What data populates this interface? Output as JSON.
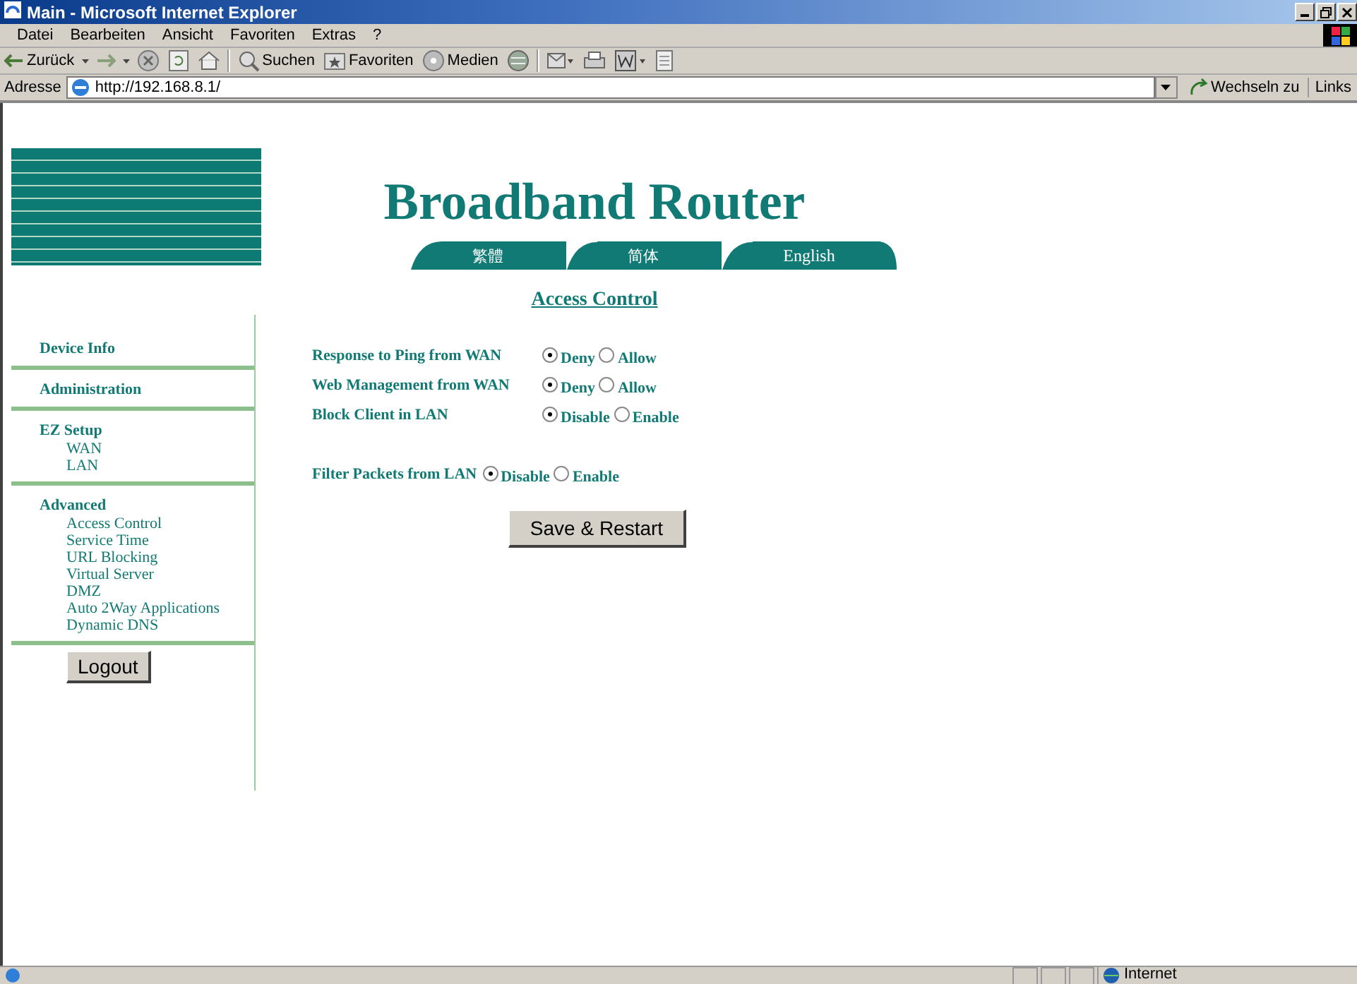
{
  "window": {
    "title": "Main - Microsoft Internet Explorer"
  },
  "menu": [
    "Datei",
    "Bearbeiten",
    "Ansicht",
    "Favoriten",
    "Extras",
    "?"
  ],
  "toolbar": [
    {
      "kind": "back",
      "label": "Zurück"
    },
    {
      "kind": "forward"
    },
    {
      "kind": "stop"
    },
    {
      "kind": "refresh"
    },
    {
      "kind": "home"
    },
    {
      "kind": "search",
      "label": "Suchen"
    },
    {
      "kind": "favorites",
      "label": "Favoriten"
    },
    {
      "kind": "media",
      "label": "Medien"
    },
    {
      "kind": "history"
    },
    {
      "kind": "mail"
    },
    {
      "kind": "print"
    },
    {
      "kind": "edit"
    },
    {
      "kind": "discuss"
    }
  ],
  "address": {
    "label": "Adresse",
    "value": "http://192.168.8.1/",
    "go": "Wechseln zu",
    "links": "Links"
  },
  "page": {
    "title": "Broadband Router",
    "languages": [
      "繁體",
      "简体",
      "English"
    ],
    "heading": "Access Control",
    "sidebar": [
      {
        "title": "Device Info"
      },
      {
        "title": "Administration"
      },
      {
        "title": "EZ Setup",
        "items": [
          "WAN",
          "LAN"
        ]
      },
      {
        "title": "Advanced",
        "items": [
          "Access Control",
          "Service Time",
          "URL Blocking",
          "Virtual Server",
          "DMZ",
          "Auto 2Way Applications",
          "Dynamic DNS"
        ]
      }
    ],
    "logout": "Logout",
    "settings": [
      {
        "label": "Response to Ping from WAN",
        "options": [
          {
            "label": "Deny",
            "selected": true
          },
          {
            "label": "Allow",
            "selected": false
          }
        ]
      },
      {
        "label": "Web Management from WAN",
        "options": [
          {
            "label": "Deny",
            "selected": true
          },
          {
            "label": "Allow",
            "selected": false
          }
        ]
      },
      {
        "label": "Block Client in LAN",
        "options": [
          {
            "label": "Disable",
            "selected": true
          },
          {
            "label": "Enable",
            "selected": false
          }
        ]
      }
    ],
    "filter": {
      "label": "Filter Packets from LAN",
      "options": [
        {
          "label": "Disable",
          "selected": true
        },
        {
          "label": "Enable",
          "selected": false
        }
      ]
    },
    "save": "Save & Restart"
  },
  "status_bar": {
    "zone": "Internet"
  }
}
